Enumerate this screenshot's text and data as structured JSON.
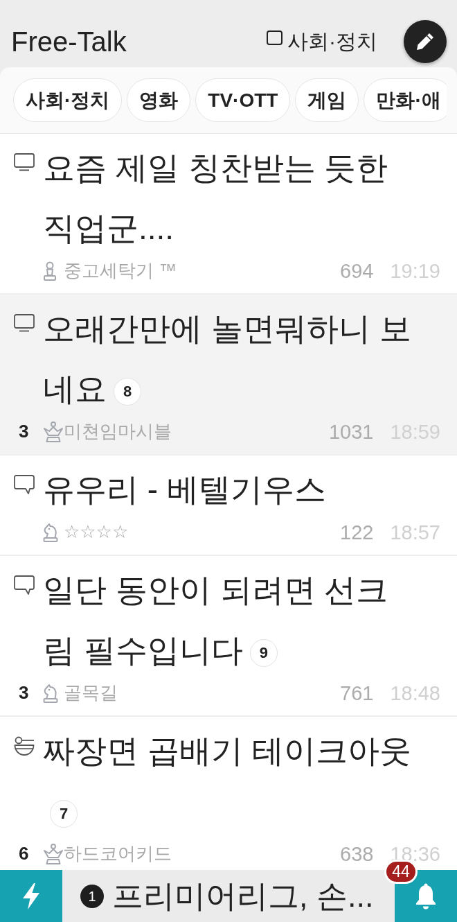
{
  "header": {
    "title": "Free-Talk",
    "filter_checkbox": {
      "label": "사회·정치",
      "checked": false
    }
  },
  "category_chips": [
    {
      "label": "사회·정치",
      "selected": false
    },
    {
      "label": "영화",
      "selected": false
    },
    {
      "label": "TV·OTT",
      "selected": false
    },
    {
      "label": "게임",
      "selected": false
    },
    {
      "label": "만화·애",
      "selected": false
    }
  ],
  "posts": [
    {
      "kind": "tv",
      "title": "요즘 제일 칭찬받는 듯한 직업군....",
      "author": {
        "kind": "pawn",
        "name": "중고세탁기 ™"
      },
      "views": "694",
      "time": "19:19",
      "highlighted": false
    },
    {
      "kind": "tv",
      "title": "오래간만에 놀면뭐하니 보네요",
      "comment_count": "8",
      "votes": "3",
      "author": {
        "kind": "queen",
        "name": "미쳔임마시블"
      },
      "views": "1031",
      "time": "18:59",
      "highlighted": true
    },
    {
      "kind": "chat",
      "title": "유우리 - 베텔기우스",
      "author": {
        "kind": "knight",
        "name": "☆☆☆☆"
      },
      "views": "122",
      "time": "18:57",
      "highlighted": false
    },
    {
      "kind": "chat",
      "title": "일단 동안이 되려면 선크림 필수입니다",
      "comment_count": "9",
      "votes": "3",
      "author": {
        "kind": "knight",
        "name": "골목길"
      },
      "views": "761",
      "time": "18:48",
      "highlighted": false
    },
    {
      "kind": "food",
      "title": "짜장면 곱배기 테이크아웃",
      "comment_count": "7",
      "votes": "6",
      "author": {
        "kind": "queen",
        "name": "하드코어키드"
      },
      "views": "638",
      "time": "18:36",
      "highlighted": false
    }
  ],
  "bottom_bar": {
    "headline": {
      "rank": "1",
      "text": "프리미어리그, 손..."
    },
    "notification_count": "44"
  }
}
